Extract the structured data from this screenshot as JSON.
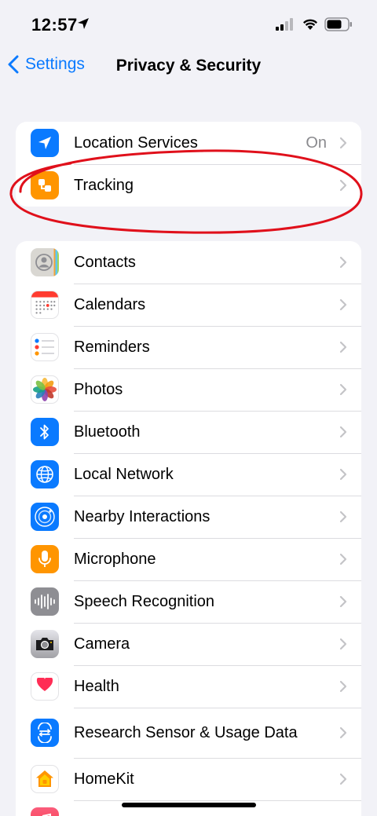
{
  "status_bar": {
    "time": "12:57",
    "location_icon": "location-arrow-icon",
    "signal_icon": "cellular-signal-icon",
    "wifi_icon": "wifi-icon",
    "battery_icon": "battery-icon"
  },
  "nav": {
    "back_label": "Settings",
    "title": "Privacy & Security"
  },
  "top_group": [
    {
      "label": "Location Services",
      "value": "On",
      "icon": "location-icon",
      "color": "#0a7aff"
    },
    {
      "label": "Tracking",
      "value": "",
      "icon": "tracking-icon",
      "color": "#ff9500"
    }
  ],
  "main_group": [
    {
      "label": "Contacts",
      "icon": "contacts-icon"
    },
    {
      "label": "Calendars",
      "icon": "calendar-icon"
    },
    {
      "label": "Reminders",
      "icon": "reminders-icon"
    },
    {
      "label": "Photos",
      "icon": "photos-icon"
    },
    {
      "label": "Bluetooth",
      "icon": "bluetooth-icon",
      "color": "#0a7aff"
    },
    {
      "label": "Local Network",
      "icon": "globe-icon",
      "color": "#0a7aff"
    },
    {
      "label": "Nearby Interactions",
      "icon": "nearby-icon",
      "color": "#0a7aff"
    },
    {
      "label": "Microphone",
      "icon": "microphone-icon",
      "color": "#ff9500"
    },
    {
      "label": "Speech Recognition",
      "icon": "waveform-icon",
      "color": "#8e8e93"
    },
    {
      "label": "Camera",
      "icon": "camera-icon",
      "color": "#636366"
    },
    {
      "label": "Health",
      "icon": "heart-icon",
      "color": "#ff2d55"
    },
    {
      "label": "Research Sensor & Usage Data",
      "icon": "research-icon",
      "color": "#0a7aff"
    },
    {
      "label": "HomeKit",
      "icon": "home-icon",
      "color": "#ff9500"
    },
    {
      "label": "",
      "icon": "music-icon",
      "color": "#ff3b5c"
    }
  ],
  "annotation_color": "#e0101b"
}
